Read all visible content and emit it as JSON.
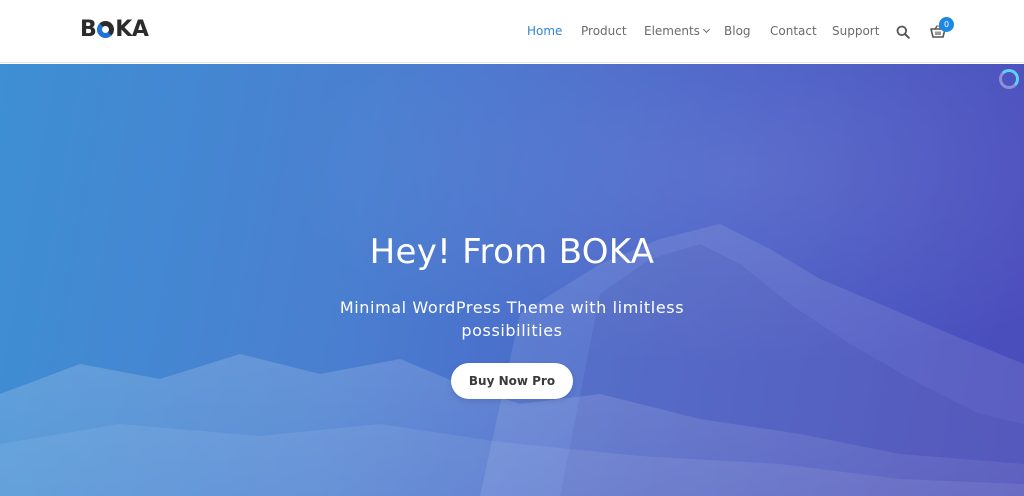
{
  "header": {
    "logo": {
      "part1": "B",
      "part2": "KA"
    },
    "nav": [
      {
        "label": "Home",
        "active": true
      },
      {
        "label": "Product"
      },
      {
        "label": "Elements",
        "has_dropdown": true
      },
      {
        "label": "Blog"
      },
      {
        "label": "Contact"
      },
      {
        "label": "Support"
      }
    ],
    "search_icon": "search-icon",
    "cart_icon": "cart-icon",
    "cart_count": "0"
  },
  "hero": {
    "title": "Hey! From BOKA",
    "subtitle_line1": "Minimal WordPress Theme with limitless",
    "subtitle_line2": "possibilities",
    "cta_label": "Buy Now Pro",
    "loading_icon": "loading-spinner-icon"
  },
  "colors": {
    "accent": "#2f86d6",
    "badge": "#1e88e5",
    "nav_text": "#6b6b6b",
    "hero_start": "#3e8fd3",
    "hero_end": "#4a4bbb",
    "text_white": "#ffffff"
  }
}
